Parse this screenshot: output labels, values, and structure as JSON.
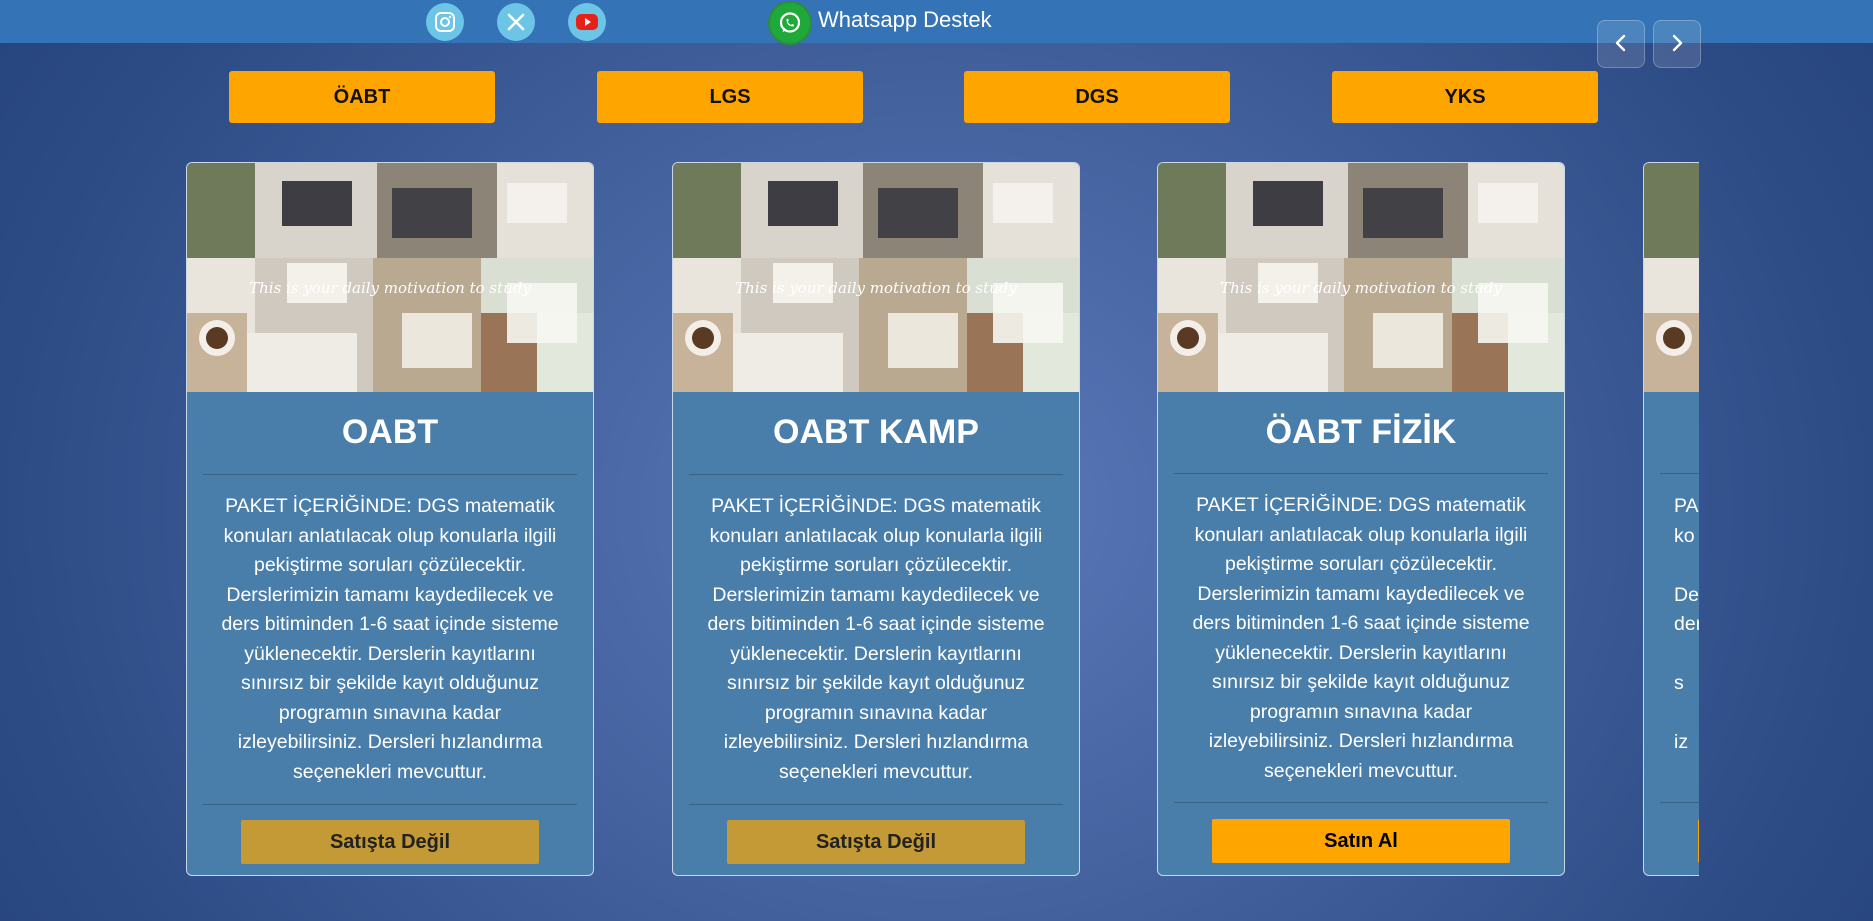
{
  "topbar": {
    "social": [
      {
        "name": "instagram-icon",
        "color": "#6cc5e6"
      },
      {
        "name": "x-twitter-icon",
        "color": "#6cc5e6"
      },
      {
        "name": "youtube-icon",
        "color": "#6cc5e6"
      }
    ],
    "whatsapp_label": "Whatsapp Destek"
  },
  "carousel_nav": {
    "prev_icon": "chevron-left-icon",
    "next_icon": "chevron-right-icon"
  },
  "categories": [
    "ÖABT",
    "LGS",
    "DGS",
    "YKS"
  ],
  "cards": [
    {
      "title": "OABT",
      "image_caption": "This is your daily motivation to study",
      "description": "PAKET İÇERİĞİNDE: DGS matematik konuları anlatılacak olup konularla ilgili pekiştirme soruları çözülecektir. Derslerimizin tamamı kaydedilecek ve ders bitiminden 1-6 saat içinde sisteme yüklenecektir. Derslerin kayıtlarını sınırsız bir şekilde kayıt olduğunuz programın sınavına kadar izleyebilirsiniz. Dersleri hızlandırma seçenekleri mevcuttur.",
      "button": "Satışta Değil",
      "available": false
    },
    {
      "title": "OABT KAMP",
      "image_caption": "This is your daily motivation to study",
      "description": "PAKET İÇERİĞİNDE: DGS matematik konuları anlatılacak olup konularla ilgili pekiştirme soruları çözülecektir. Derslerimizin tamamı kaydedilecek ve ders bitiminden 1-6 saat içinde sisteme yüklenecektir. Derslerin kayıtlarını sınırsız bir şekilde kayıt olduğunuz programın sınavına kadar izleyebilirsiniz. Dersleri hızlandırma seçenekleri mevcuttur.",
      "button": "Satışta Değil",
      "available": false
    },
    {
      "title": "ÖABT FİZİK",
      "image_caption": "This is your daily motivation to study",
      "description": "PAKET İÇERİĞİNDE: DGS matematik konuları anlatılacak olup konularla ilgili pekiştirme soruları çözülecektir. Derslerimizin tamamı kaydedilecek ve ders bitiminden 1-6 saat içinde sisteme yüklenecektir. Derslerin kayıtlarını sınırsız bir şekilde kayıt olduğunuz programın sınavına kadar izleyebilirsiniz. Dersleri hızlandırma seçenekleri mevcuttur.",
      "button": "Satın Al",
      "available": true
    },
    {
      "title": "",
      "image_caption": "",
      "description": "PA\nko\n\nDe\nder\n\ns\n\niz",
      "button": "",
      "available": true
    }
  ],
  "colors": {
    "topbar": "#3473b5",
    "category_button": "#ffa500",
    "buy_button": "#ffa500",
    "not_for_sale_button": "#c39a35",
    "card_body": "#4a7eaa"
  }
}
